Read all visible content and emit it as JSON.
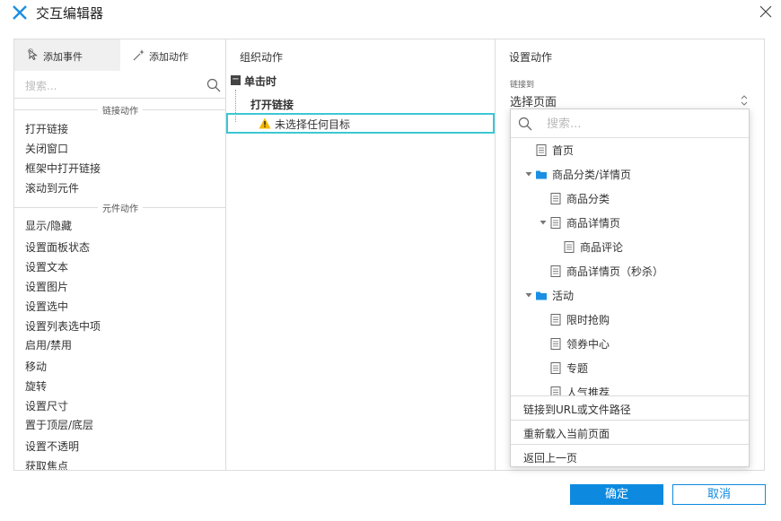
{
  "window": {
    "title": "交互编辑器"
  },
  "left_panel": {
    "tabs": [
      {
        "label": "添加事件",
        "active": true
      },
      {
        "label": "添加动作",
        "active": false
      }
    ],
    "search_placeholder": "搜索...",
    "groups": [
      {
        "title": "链接动作",
        "items": [
          "打开链接",
          "关闭窗口",
          "框架中打开链接",
          "滚动到元件"
        ]
      },
      {
        "title": "元件动作",
        "items": [
          "显示/隐藏",
          "设置面板状态",
          "设置文本",
          "设置图片",
          "设置选中",
          "设置列表选中项",
          "启用/禁用",
          "移动",
          "旋转",
          "设置尺寸",
          "置于顶层/底层",
          "设置不透明",
          "获取焦点"
        ]
      }
    ]
  },
  "middle_panel": {
    "title": "组织动作",
    "event": "单击时",
    "action": "打开链接",
    "target": "未选择任何目标"
  },
  "right_panel": {
    "title": "设置动作",
    "link_label": "链接到",
    "select_value": "选择页面"
  },
  "dropdown": {
    "search_placeholder": "搜索...",
    "tree": [
      {
        "label": "首页",
        "type": "page",
        "level": 0
      },
      {
        "label": "商品分类/详情页",
        "type": "folder",
        "level": 0,
        "expanded": true
      },
      {
        "label": "商品分类",
        "type": "page",
        "level": 1
      },
      {
        "label": "商品详情页",
        "type": "page",
        "level": 1,
        "expanded": true
      },
      {
        "label": "商品评论",
        "type": "page",
        "level": 2
      },
      {
        "label": "商品详情页（秒杀）",
        "type": "page",
        "level": 1
      },
      {
        "label": "活动",
        "type": "folder",
        "level": 0,
        "expanded": true
      },
      {
        "label": "限时抢购",
        "type": "page",
        "level": 1
      },
      {
        "label": "领券中心",
        "type": "page",
        "level": 1
      },
      {
        "label": "专题",
        "type": "page",
        "level": 1
      },
      {
        "label": "人气推荐",
        "type": "page",
        "level": 1
      }
    ],
    "options": [
      "链接到URL或文件路径",
      "重新载入当前页面",
      "返回上一页"
    ]
  },
  "buttons": {
    "ok": "确定",
    "cancel": "取消"
  },
  "colors": {
    "accent": "#0d8ae0",
    "selection": "#3dc7d4",
    "folder": "#1a8fe3",
    "warning": "#f5b800"
  }
}
